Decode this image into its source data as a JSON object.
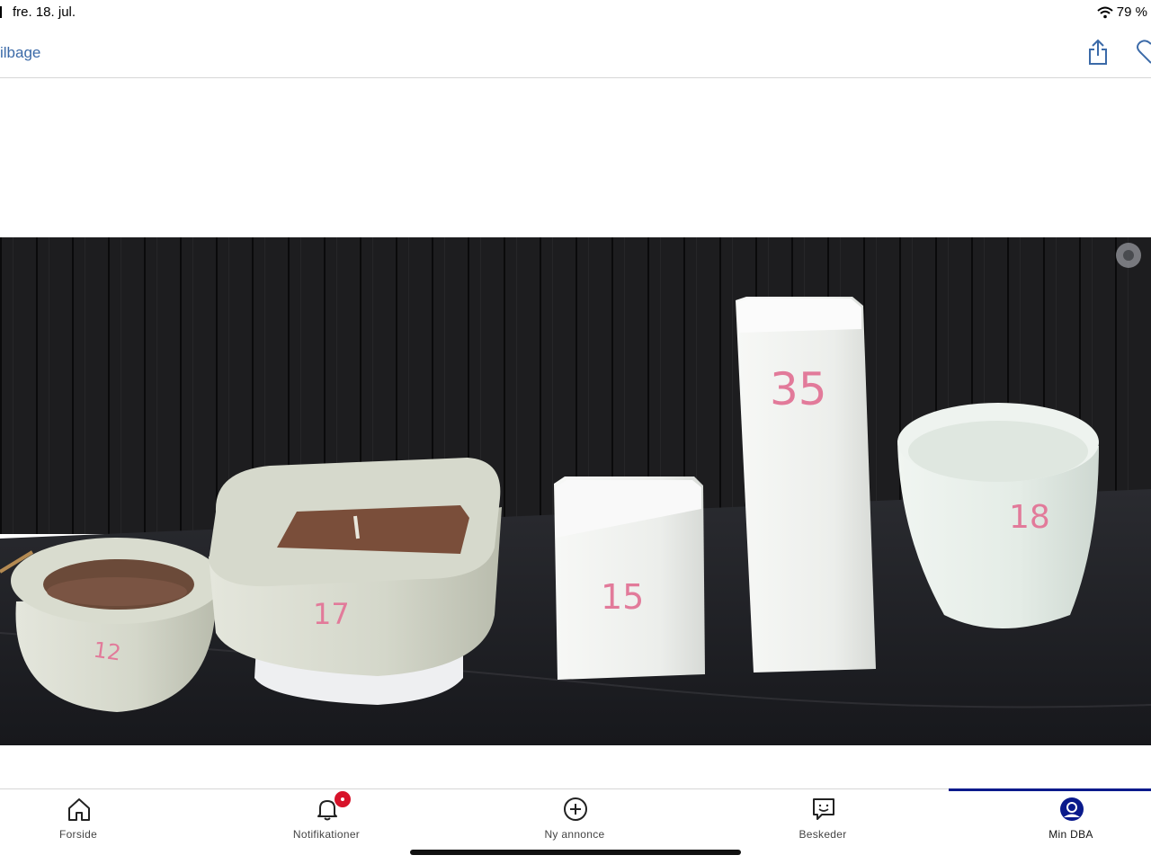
{
  "status": {
    "date": "fre. 18. jul.",
    "battery": "79 %"
  },
  "nav": {
    "back_label": "ilbage"
  },
  "listing_image": {
    "items": [
      {
        "label": "12"
      },
      {
        "label": "17"
      },
      {
        "label": "15"
      },
      {
        "label": "35"
      },
      {
        "label": "18"
      }
    ]
  },
  "tabs": [
    {
      "label": "Forside",
      "icon": "home-icon"
    },
    {
      "label": "Notifikationer",
      "icon": "bell-icon"
    },
    {
      "label": "Ny annonce",
      "icon": "plus-circle-icon"
    },
    {
      "label": "Beskeder",
      "icon": "message-icon"
    },
    {
      "label": "Min DBA",
      "icon": "profile-icon"
    }
  ],
  "colors": {
    "accent": "#3b6aa8",
    "active_tab": "#0a1a8c",
    "badge": "#d7132a"
  }
}
